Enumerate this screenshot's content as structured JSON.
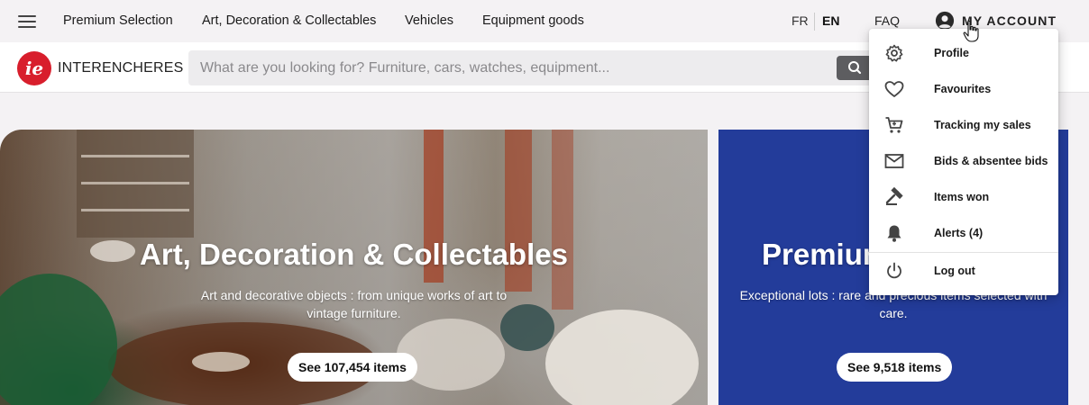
{
  "topnav": {
    "items": [
      "Premium Selection",
      "Art, Decoration & Collectables",
      "Vehicles",
      "Equipment goods"
    ],
    "lang_fr": "FR",
    "lang_en": "EN",
    "faq": "FAQ",
    "account_label": "MY ACCOUNT"
  },
  "brand": {
    "logo_text": "INTERENCHERES",
    "logo_mark": "ie",
    "accent": "#d81e2c"
  },
  "search": {
    "placeholder": "What are you looking for? Furniture, cars, watches, equipment..."
  },
  "cards": [
    {
      "title": "Art, Decoration & Collectables",
      "description_line1": "Art and decorative objects : from unique works of art to",
      "description_line2": "vintage furniture.",
      "button": "See 107,454 items"
    },
    {
      "title": "Premium",
      "description_line1": "Exceptional lots : rare and precious items selected with",
      "description_line2": "care.",
      "button": "See 9,518 items",
      "background": "#233c9a"
    }
  ],
  "account_menu": {
    "items": [
      {
        "label": "Profile",
        "icon": "gear-icon"
      },
      {
        "label": "Favourites",
        "icon": "heart-icon"
      },
      {
        "label": "Tracking my sales",
        "icon": "cart-icon"
      },
      {
        "label": "Bids & absentee bids",
        "icon": "mail-icon"
      },
      {
        "label": "Items won",
        "icon": "gavel-icon"
      },
      {
        "label": "Alerts (4)",
        "icon": "bell-icon"
      },
      {
        "label": "Log out",
        "icon": "power-icon"
      }
    ]
  }
}
